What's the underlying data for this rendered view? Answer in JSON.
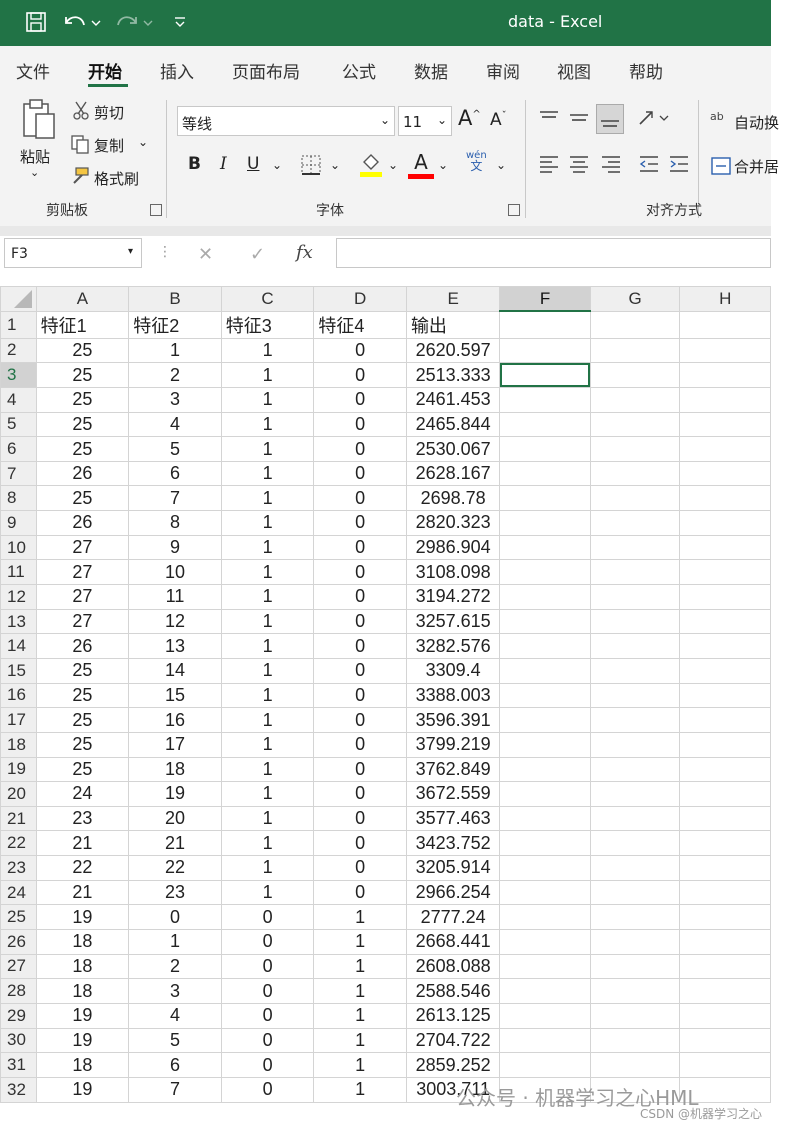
{
  "window": {
    "title": "data - Excel"
  },
  "title_icons": [
    "save-icon",
    "undo-icon",
    "redo-icon",
    "customize-icon"
  ],
  "menu": {
    "tabs": [
      "文件",
      "开始",
      "插入",
      "页面布局",
      "公式",
      "数据",
      "审阅",
      "视图",
      "帮助"
    ],
    "active": "开始"
  },
  "ribbon": {
    "clipboard": {
      "paste": "粘贴",
      "cut": "剪切",
      "copy": "复制",
      "format_painter": "格式刷",
      "group": "剪贴板"
    },
    "font": {
      "name": "等线",
      "size": "11",
      "group": "字体",
      "bold": "B",
      "italic": "I",
      "underline": "U",
      "font_color": "A",
      "grow": "A",
      "shrink": "A",
      "wen": "wén",
      "wen2": "文"
    },
    "align": {
      "wrap": "自动换",
      "merge": "合并居",
      "group": "对齐方式",
      "wrap_glyph": "ab"
    }
  },
  "formula_bar": {
    "name_box": "F3",
    "cancel": "✕",
    "enter": "✓",
    "fx": "fx",
    "formula": ""
  },
  "sheet": {
    "columns": [
      "A",
      "B",
      "C",
      "D",
      "E",
      "F",
      "G",
      "H"
    ],
    "selected_column": "F",
    "selected_row": "3",
    "active_cell": "F3",
    "rows": [
      {
        "n": "1",
        "cells": [
          "特征1",
          "特征2",
          "特征3",
          "特征4",
          "输出",
          "",
          "",
          ""
        ]
      },
      {
        "n": "2",
        "cells": [
          "25",
          "1",
          "1",
          "0",
          "2620.597",
          "",
          "",
          ""
        ]
      },
      {
        "n": "3",
        "cells": [
          "25",
          "2",
          "1",
          "0",
          "2513.333",
          "",
          "",
          ""
        ]
      },
      {
        "n": "4",
        "cells": [
          "25",
          "3",
          "1",
          "0",
          "2461.453",
          "",
          "",
          ""
        ]
      },
      {
        "n": "5",
        "cells": [
          "25",
          "4",
          "1",
          "0",
          "2465.844",
          "",
          "",
          ""
        ]
      },
      {
        "n": "6",
        "cells": [
          "25",
          "5",
          "1",
          "0",
          "2530.067",
          "",
          "",
          ""
        ]
      },
      {
        "n": "7",
        "cells": [
          "26",
          "6",
          "1",
          "0",
          "2628.167",
          "",
          "",
          ""
        ]
      },
      {
        "n": "8",
        "cells": [
          "25",
          "7",
          "1",
          "0",
          "2698.78",
          "",
          "",
          ""
        ]
      },
      {
        "n": "9",
        "cells": [
          "26",
          "8",
          "1",
          "0",
          "2820.323",
          "",
          "",
          ""
        ]
      },
      {
        "n": "10",
        "cells": [
          "27",
          "9",
          "1",
          "0",
          "2986.904",
          "",
          "",
          ""
        ]
      },
      {
        "n": "11",
        "cells": [
          "27",
          "10",
          "1",
          "0",
          "3108.098",
          "",
          "",
          ""
        ]
      },
      {
        "n": "12",
        "cells": [
          "27",
          "11",
          "1",
          "0",
          "3194.272",
          "",
          "",
          ""
        ]
      },
      {
        "n": "13",
        "cells": [
          "27",
          "12",
          "1",
          "0",
          "3257.615",
          "",
          "",
          ""
        ]
      },
      {
        "n": "14",
        "cells": [
          "26",
          "13",
          "1",
          "0",
          "3282.576",
          "",
          "",
          ""
        ]
      },
      {
        "n": "15",
        "cells": [
          "25",
          "14",
          "1",
          "0",
          "3309.4",
          "",
          "",
          ""
        ]
      },
      {
        "n": "16",
        "cells": [
          "25",
          "15",
          "1",
          "0",
          "3388.003",
          "",
          "",
          ""
        ]
      },
      {
        "n": "17",
        "cells": [
          "25",
          "16",
          "1",
          "0",
          "3596.391",
          "",
          "",
          ""
        ]
      },
      {
        "n": "18",
        "cells": [
          "25",
          "17",
          "1",
          "0",
          "3799.219",
          "",
          "",
          ""
        ]
      },
      {
        "n": "19",
        "cells": [
          "25",
          "18",
          "1",
          "0",
          "3762.849",
          "",
          "",
          ""
        ]
      },
      {
        "n": "20",
        "cells": [
          "24",
          "19",
          "1",
          "0",
          "3672.559",
          "",
          "",
          ""
        ]
      },
      {
        "n": "21",
        "cells": [
          "23",
          "20",
          "1",
          "0",
          "3577.463",
          "",
          "",
          ""
        ]
      },
      {
        "n": "22",
        "cells": [
          "21",
          "21",
          "1",
          "0",
          "3423.752",
          "",
          "",
          ""
        ]
      },
      {
        "n": "23",
        "cells": [
          "22",
          "22",
          "1",
          "0",
          "3205.914",
          "",
          "",
          ""
        ]
      },
      {
        "n": "24",
        "cells": [
          "21",
          "23",
          "1",
          "0",
          "2966.254",
          "",
          "",
          ""
        ]
      },
      {
        "n": "25",
        "cells": [
          "19",
          "0",
          "0",
          "1",
          "2777.24",
          "",
          "",
          ""
        ]
      },
      {
        "n": "26",
        "cells": [
          "18",
          "1",
          "0",
          "1",
          "2668.441",
          "",
          "",
          ""
        ]
      },
      {
        "n": "27",
        "cells": [
          "18",
          "2",
          "0",
          "1",
          "2608.088",
          "",
          "",
          ""
        ]
      },
      {
        "n": "28",
        "cells": [
          "18",
          "3",
          "0",
          "1",
          "2588.546",
          "",
          "",
          ""
        ]
      },
      {
        "n": "29",
        "cells": [
          "19",
          "4",
          "0",
          "1",
          "2613.125",
          "",
          "",
          ""
        ]
      },
      {
        "n": "30",
        "cells": [
          "19",
          "5",
          "0",
          "1",
          "2704.722",
          "",
          "",
          ""
        ]
      },
      {
        "n": "31",
        "cells": [
          "18",
          "6",
          "0",
          "1",
          "2859.252",
          "",
          "",
          ""
        ]
      },
      {
        "n": "32",
        "cells": [
          "19",
          "7",
          "0",
          "1",
          "3003.711",
          "",
          "",
          ""
        ]
      }
    ]
  },
  "watermark": {
    "text": "公众号 · 机器学习之心HML",
    "sub": "CSDN @机器学习之心"
  },
  "colors": {
    "excel_green": "#217346",
    "highlight_yellow": "#ffff00",
    "font_red": "#ff0000"
  }
}
